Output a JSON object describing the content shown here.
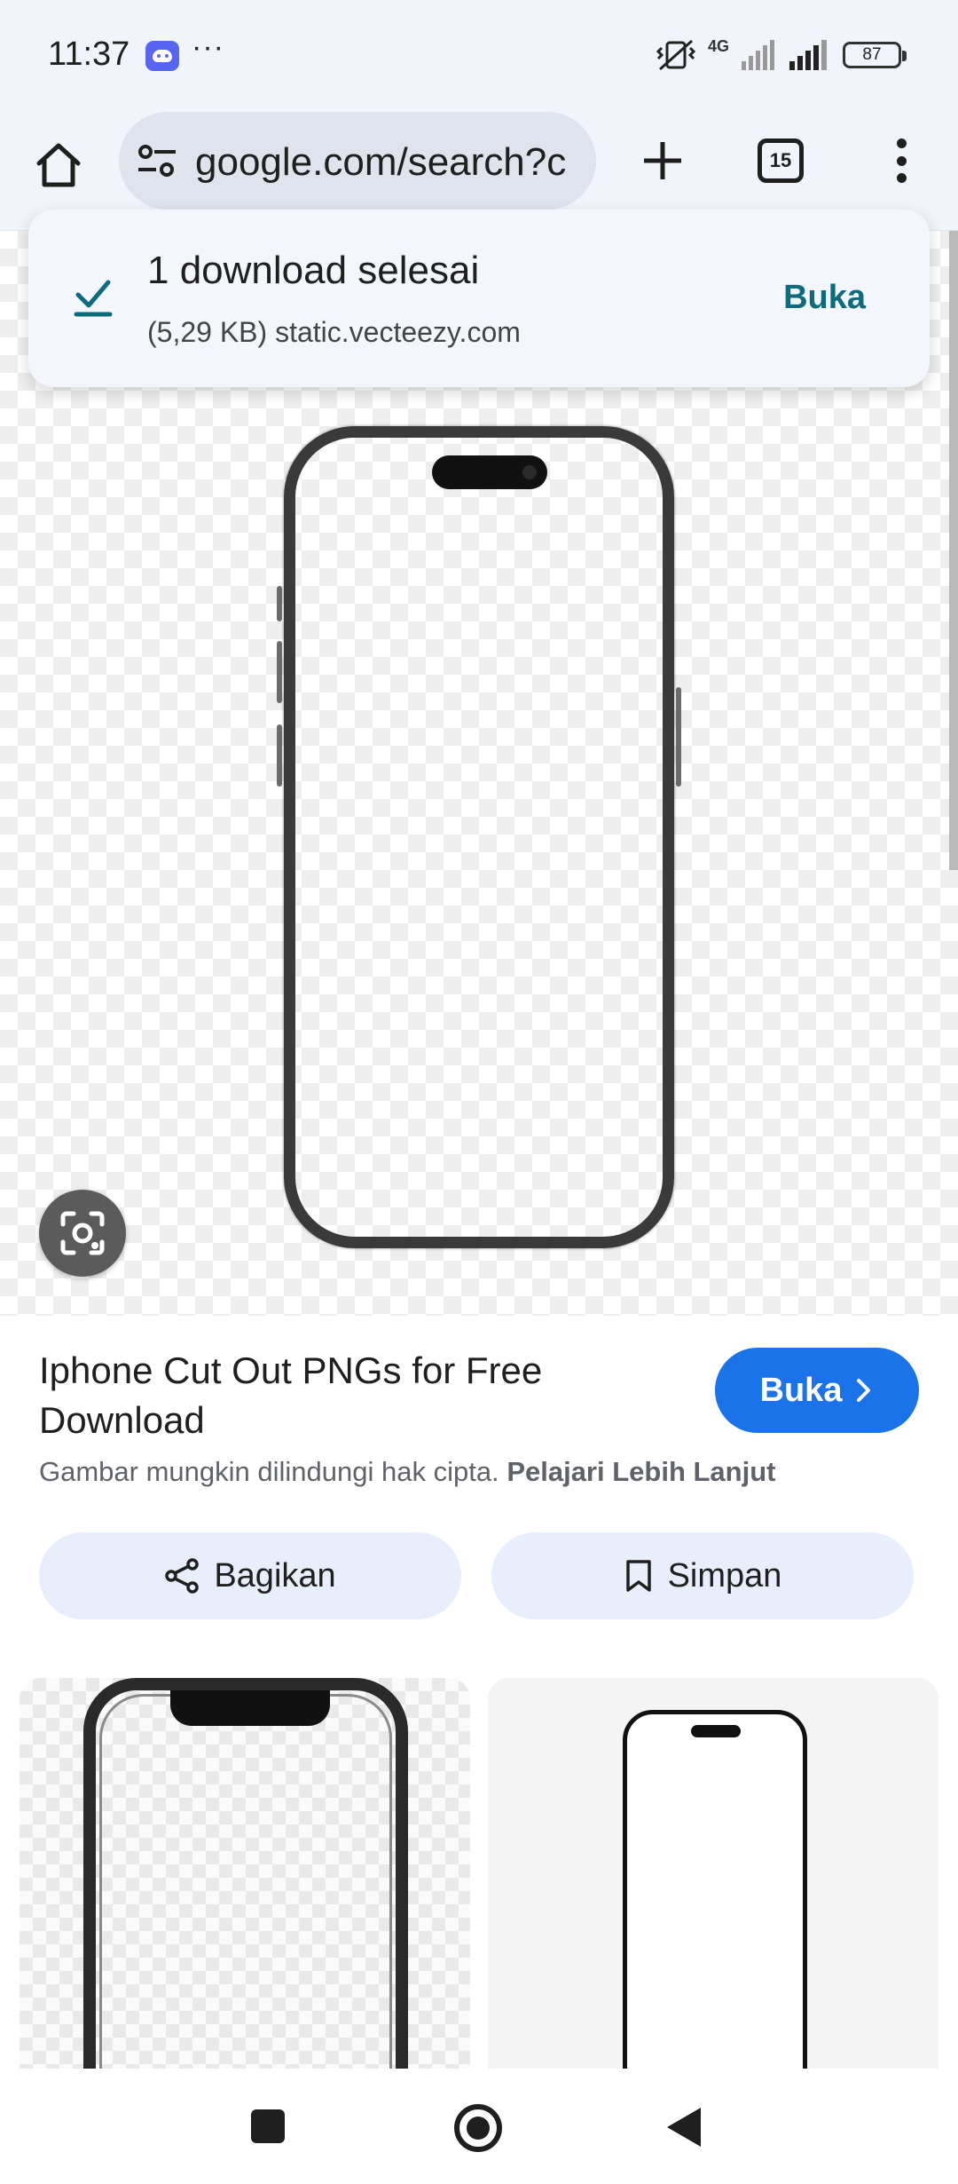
{
  "status_bar": {
    "time": "11:37",
    "overflow_indicator": "···",
    "network_label": "4G",
    "battery_level": "87",
    "notification_app": "discord-icon"
  },
  "browser": {
    "url": "google.com/search?c",
    "tab_count": "15"
  },
  "download_snackbar": {
    "title": "1 download selesai",
    "subtitle": "(5,29 KB) static.vecteezy.com",
    "action_label": "Buka",
    "accent_color": "#0e6b7b"
  },
  "result": {
    "title": "Iphone Cut Out PNGs for Free Download",
    "open_label": "Buka",
    "copyright_text": "Gambar mungkin dilindungi hak cipta.",
    "learn_more_label": "Pelajari Lebih Lanjut",
    "share_label": "Bagikan",
    "save_label": "Simpan",
    "primary_color": "#1a73e8"
  },
  "icons": {
    "home": "home-icon",
    "site_settings": "tune-icon",
    "new_tab": "plus-icon",
    "menu": "more-vert-icon",
    "lens": "google-lens-icon",
    "share": "share-icon",
    "bookmark": "bookmark-icon",
    "check": "download-done-icon",
    "chevron": "chevron-right-icon"
  }
}
